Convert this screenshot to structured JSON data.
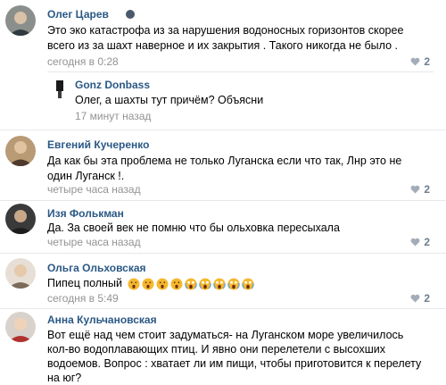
{
  "comments": [
    {
      "author": "Олег Царев",
      "text": "Это эко катастрофа из за нарушения водоносных горизонтов скорее всего из за шахт наверное и их закрытия . Такого никогда не было .",
      "time": "сегодня в 0:28",
      "likes": "2",
      "reply": {
        "author": "Gonz Donbass",
        "text": "Олег, а шахты тут причём? Объясни",
        "time": "17 минут назад"
      }
    },
    {
      "author": "Евгений Кучеренко",
      "text": "Да как бы эта проблема не только Луганска если что так, Лнр это не один Луганск !.",
      "time": "четыре часа назад",
      "likes": "2"
    },
    {
      "author": "Изя Фолькман",
      "text": "Да. За своей век не помню что бы ольховка пересыхала",
      "time": "четыре часа назад",
      "likes": "2"
    },
    {
      "author": "Ольга Ольховская",
      "text": "Пипец полный",
      "time": "сегодня в 5:49",
      "likes": "2",
      "emojis": [
        "astonished-face",
        "astonished-face",
        "astonished-face",
        "astonished-face",
        "screaming-face",
        "screaming-face",
        "screaming-face",
        "screaming-face",
        "screaming-face"
      ]
    },
    {
      "author": "Анна Кульчановская",
      "text": "Вот ещё над чем стоит задуматься- на Луганском море увеличилось кол-во водоплавающих птиц. И явно они перелетели с высохших водоемов. Вопрос : хватает ли им пищи, чтобы приготовится к перелету на юг?"
    }
  ],
  "colors": {
    "link": "#2a5885",
    "meta": "#939393",
    "divider": "#e7e8ec"
  }
}
